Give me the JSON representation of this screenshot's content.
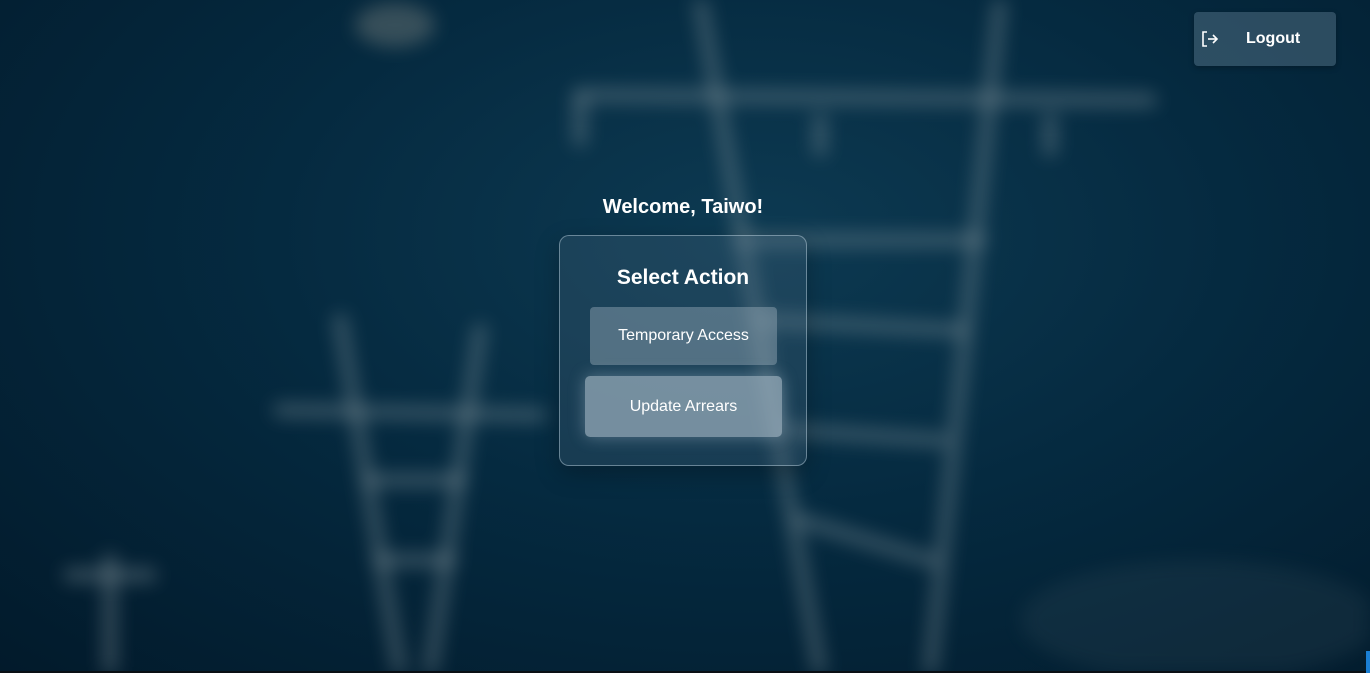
{
  "header": {
    "logout_label": "Logout",
    "logout_icon": "logout-arrow-icon"
  },
  "main": {
    "welcome_text": "Welcome, Taiwo!",
    "card": {
      "title": "Select Action",
      "actions": [
        {
          "label": "Temporary Access"
        },
        {
          "label": "Update Arrears"
        }
      ]
    }
  },
  "theme": {
    "background": "#052a40",
    "accent": "#1a7fd4"
  }
}
